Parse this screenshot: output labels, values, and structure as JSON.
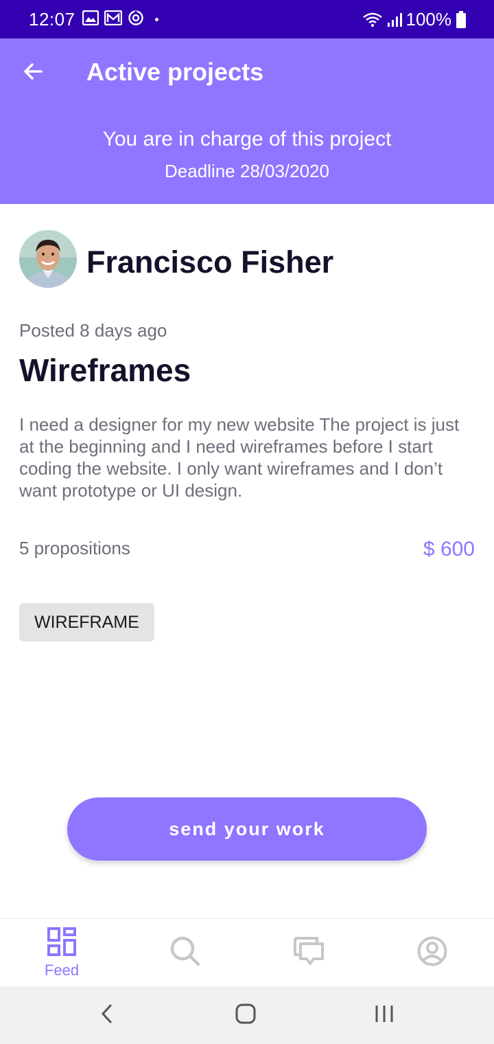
{
  "status_bar": {
    "time": "12:07",
    "battery": "100%",
    "icons_left": [
      "gallery-icon",
      "gmail-icon",
      "sync-icon"
    ],
    "icons_right": [
      "wifi-icon",
      "signal-icon",
      "battery-icon"
    ]
  },
  "app_bar": {
    "title": "Active projects",
    "back_icon": "arrow-left-icon"
  },
  "banner": {
    "title": "You are in charge of this project",
    "deadline": "Deadline 28/03/2020"
  },
  "project": {
    "author": "Francisco Fisher",
    "posted": "Posted 8 days ago",
    "title": "Wireframes",
    "description": "I need a designer for my new website The project is just at the beginning and I need wireframes before I start coding the website. I only want wireframes and I don’t want prototype or UI design.",
    "propositions": "5 propositions",
    "price": "$ 600",
    "tags": [
      "WIREFRAME"
    ]
  },
  "actions": {
    "send_label": "send your work"
  },
  "bottom_nav": {
    "items": [
      {
        "label": "Feed",
        "icon": "feed-grid-icon",
        "active": true
      },
      {
        "label": "",
        "icon": "search-icon",
        "active": false
      },
      {
        "label": "",
        "icon": "chat-icon",
        "active": false
      },
      {
        "label": "",
        "icon": "profile-icon",
        "active": false
      }
    ]
  },
  "colors": {
    "status_bar": "#3300b2",
    "accent": "#8f75ff",
    "text_dark": "#14112b",
    "text_muted": "#6e6e7a",
    "inactive_icon": "#c7c7c7"
  }
}
